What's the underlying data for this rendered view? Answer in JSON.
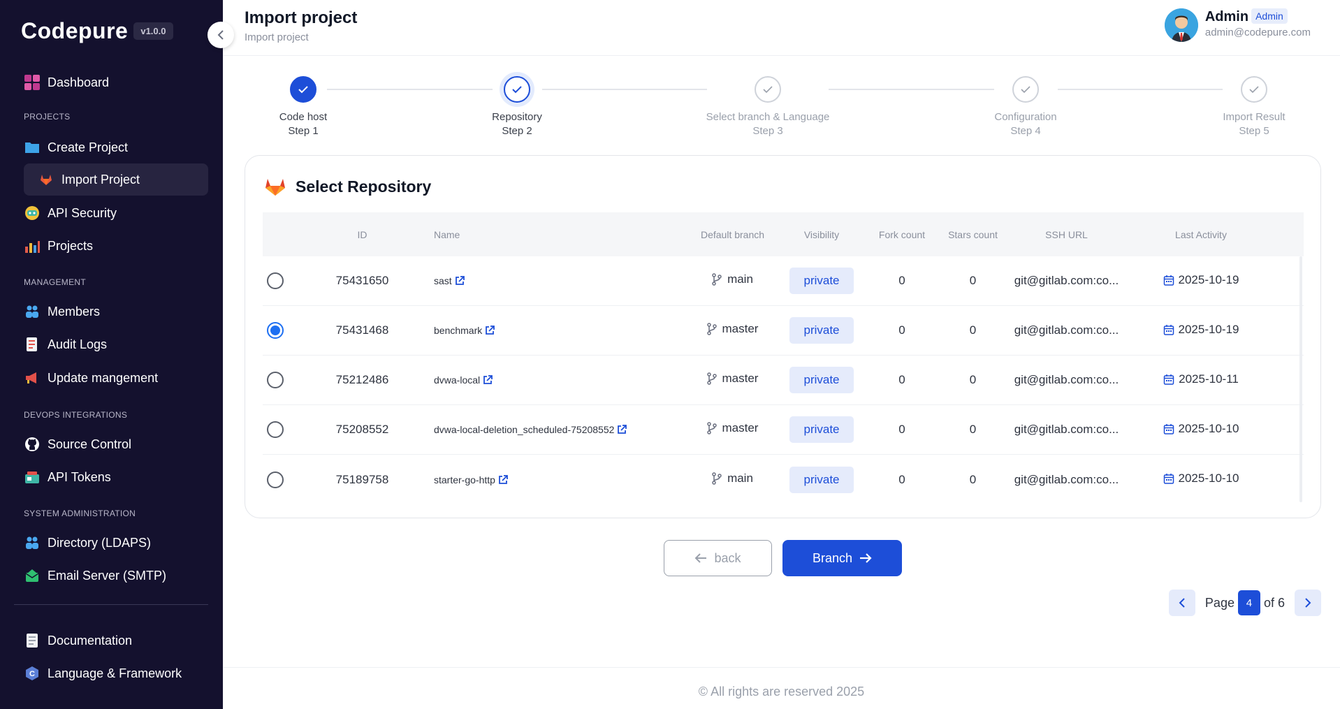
{
  "app": {
    "logo": "Codepure",
    "version": "v1.0.0"
  },
  "sidebar": {
    "sections": [
      "PROJECTS",
      "MANAGEMENT",
      "DEVOPS INTEGRATIONS",
      "SYSTEM ADMINISTRATION"
    ],
    "items": [
      {
        "label": "Dashboard",
        "icon": "dashboard-icon"
      },
      {
        "label": "Create Project",
        "icon": "folder-icon"
      },
      {
        "label": "Import Project",
        "icon": "gitlab-icon"
      },
      {
        "label": "API Security",
        "icon": "robot-icon"
      },
      {
        "label": "Projects",
        "icon": "bar-chart-icon"
      },
      {
        "label": "Members",
        "icon": "members-icon"
      },
      {
        "label": "Audit Logs",
        "icon": "audit-log-icon"
      },
      {
        "label": "Update mangement",
        "icon": "megaphone-icon"
      },
      {
        "label": "Source Control",
        "icon": "github-icon"
      },
      {
        "label": "API Tokens",
        "icon": "token-icon"
      },
      {
        "label": "Directory (LDAPS)",
        "icon": "directory-icon"
      },
      {
        "label": "Email Server (SMTP)",
        "icon": "email-server-icon"
      },
      {
        "label": "Documentation",
        "icon": "documentation-icon"
      },
      {
        "label": "Language & Framework",
        "icon": "language-icon"
      }
    ]
  },
  "header": {
    "title": "Import project",
    "subtitle": "Import project"
  },
  "user": {
    "name": "Admin",
    "role": "Admin",
    "email": "admin@codepure.com"
  },
  "stepper": {
    "steps": [
      {
        "label": "Code host",
        "step": "Step 1",
        "state": "done"
      },
      {
        "label": "Repository",
        "step": "Step 2",
        "state": "current"
      },
      {
        "label": "Select branch & Language",
        "step": "Step 3",
        "state": "pending"
      },
      {
        "label": "Configuration",
        "step": "Step 4",
        "state": "pending"
      },
      {
        "label": "Import Result",
        "step": "Step 5",
        "state": "pending"
      }
    ]
  },
  "card": {
    "title": "Select Repository"
  },
  "table": {
    "columns": [
      "ID",
      "Name",
      "Default branch",
      "Visibility",
      "Fork count",
      "Stars count",
      "SSH URL",
      "Last Activity"
    ],
    "rows": [
      {
        "selected": false,
        "id": "75431650",
        "name": "sast",
        "branch": "main",
        "visibility": "private",
        "forks": "0",
        "stars": "0",
        "ssh": "git@gitlab.com:co...",
        "activity": "2025-10-19"
      },
      {
        "selected": true,
        "id": "75431468",
        "name": "benchmark",
        "branch": "master",
        "visibility": "private",
        "forks": "0",
        "stars": "0",
        "ssh": "git@gitlab.com:co...",
        "activity": "2025-10-19"
      },
      {
        "selected": false,
        "id": "75212486",
        "name": "dvwa-local",
        "branch": "master",
        "visibility": "private",
        "forks": "0",
        "stars": "0",
        "ssh": "git@gitlab.com:co...",
        "activity": "2025-10-11"
      },
      {
        "selected": false,
        "id": "75208552",
        "name": "dvwa-local-deletion_scheduled-75208552",
        "branch": "master",
        "visibility": "private",
        "forks": "0",
        "stars": "0",
        "ssh": "git@gitlab.com:co...",
        "activity": "2025-10-10"
      },
      {
        "selected": false,
        "id": "75189758",
        "name": "starter-go-http",
        "branch": "main",
        "visibility": "private",
        "forks": "0",
        "stars": "0",
        "ssh": "git@gitlab.com:co...",
        "activity": "2025-10-10"
      }
    ]
  },
  "actions": {
    "back_label": "back",
    "next_label": "Branch"
  },
  "pagination": {
    "page_label": "Page",
    "current": "4",
    "of_label": "of 6"
  },
  "footer": {
    "text": "© All rights are reserved 2025"
  },
  "colors": {
    "accent": "#1d4ed8",
    "sidebar_bg": "#14112e",
    "badge_bg": "#e5ebfb"
  }
}
